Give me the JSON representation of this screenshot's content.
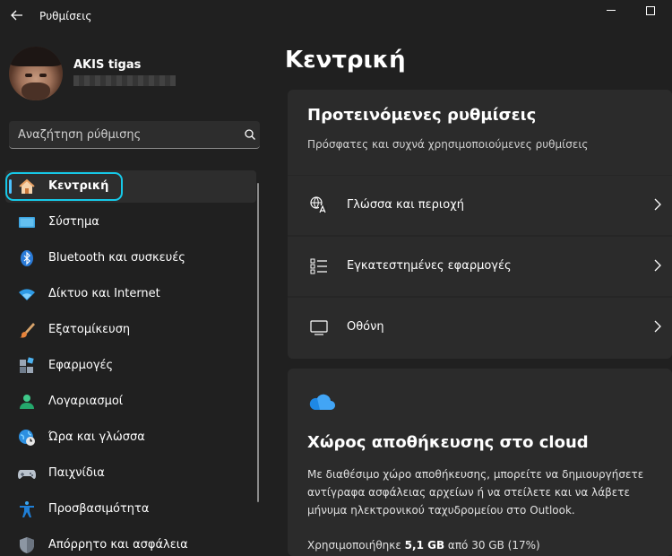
{
  "window": {
    "title": "Ρυθμίσεις"
  },
  "user": {
    "name": "AKIS tigas"
  },
  "search": {
    "placeholder": "Αναζήτηση ρύθμισης"
  },
  "sidebar": {
    "items": [
      {
        "label": "Κεντρική",
        "icon": "home-icon"
      },
      {
        "label": "Σύστημα",
        "icon": "system-icon"
      },
      {
        "label": "Bluetooth και συσκευές",
        "icon": "bluetooth-icon"
      },
      {
        "label": "Δίκτυο και Internet",
        "icon": "wifi-icon"
      },
      {
        "label": "Εξατομίκευση",
        "icon": "brush-icon"
      },
      {
        "label": "Εφαρμογές",
        "icon": "apps-icon"
      },
      {
        "label": "Λογαριασμοί",
        "icon": "account-icon"
      },
      {
        "label": "Ώρα και γλώσσα",
        "icon": "globe-clock-icon"
      },
      {
        "label": "Παιχνίδια",
        "icon": "gamepad-icon"
      },
      {
        "label": "Προσβασιμότητα",
        "icon": "accessibility-icon"
      },
      {
        "label": "Απόρρητο και ασφάλεια",
        "icon": "shield-icon"
      }
    ]
  },
  "main": {
    "title": "Κεντρική",
    "recommended": {
      "title": "Προτεινόμενες ρυθμίσεις",
      "subtitle": "Πρόσφατες και συχνά χρησιμοποιούμενες ρυθμίσεις",
      "rows": [
        {
          "label": "Γλώσσα και περιοχή",
          "icon": "language-icon"
        },
        {
          "label": "Εγκατεστημένες εφαρμογές",
          "icon": "list-icon"
        },
        {
          "label": "Οθόνη",
          "icon": "display-icon"
        }
      ]
    },
    "cloud": {
      "title": "Χώρος αποθήκευσης στο cloud",
      "description": "Με διαθέσιμο χώρο αποθήκευσης, μπορείτε να δημιουργήσετε αντίγραφα ασφάλειας αρχείων ή να στείλετε και να λάβετε μήνυμα ηλεκτρονικού ταχυδρομείου στο Outlook.",
      "usage_prefix": "Χρησιμοποιήθηκε",
      "usage_used": "5,1 GB",
      "usage_suffix": "από 30 GB (17%)"
    }
  },
  "colors": {
    "accent": "#4cc2ff",
    "highlight_ring": "#16c9e8"
  }
}
